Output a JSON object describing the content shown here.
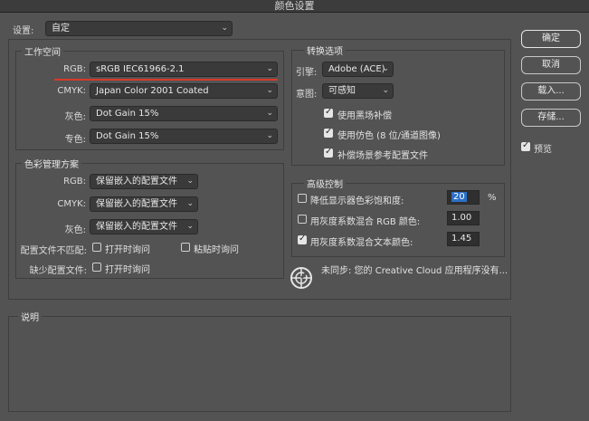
{
  "window": {
    "title": "颜色设置"
  },
  "settings": {
    "label": "设置:",
    "value": "自定"
  },
  "workspace": {
    "title": "工作空间",
    "rgb": {
      "label": "RGB:",
      "value": "sRGB IEC61966-2.1"
    },
    "cmyk": {
      "label": "CMYK:",
      "value": "Japan Color 2001 Coated"
    },
    "gray": {
      "label": "灰色:",
      "value": "Dot Gain 15%"
    },
    "spot": {
      "label": "专色:",
      "value": "Dot Gain 15%"
    }
  },
  "policies": {
    "title": "色彩管理方案",
    "rgb": {
      "label": "RGB:",
      "value": "保留嵌入的配置文件"
    },
    "cmyk": {
      "label": "CMYK:",
      "value": "保留嵌入的配置文件"
    },
    "gray": {
      "label": "灰色:",
      "value": "保留嵌入的配置文件"
    },
    "mismatch_label": "配置文件不匹配:",
    "mismatch_open": "打开时询问",
    "mismatch_paste": "粘贴时询问",
    "missing_label": "缺少配置文件:",
    "missing_open": "打开时询问"
  },
  "conversion": {
    "title": "转换选项",
    "engine": {
      "label": "引擎:",
      "value": "Adobe (ACE)"
    },
    "intent": {
      "label": "意图:",
      "value": "可感知"
    },
    "black_point": "使用黑场补偿",
    "dither": "使用仿色 (8 位/通道图像)",
    "scene_ref": "补偿场景参考配置文件"
  },
  "advanced": {
    "title": "高级控制",
    "desaturate_label": "降低显示器色彩饱和度:",
    "desaturate_value": "20",
    "desaturate_unit": "%",
    "blend_rgb_label": "用灰度系数混合 RGB 颜色:",
    "blend_rgb_value": "1.00",
    "blend_text_label": "用灰度系数混合文本颜色:",
    "blend_text_value": "1.45"
  },
  "sync": {
    "text": "未同步: 您的 Creative Cloud 应用程序没有..."
  },
  "description": {
    "title": "说明"
  },
  "buttons": {
    "ok": "确定",
    "cancel": "取消",
    "load": "载入...",
    "save": "存储...",
    "preview": "预览"
  },
  "colors": {
    "accent_line": "#d73a2a",
    "selection": "#2c6fc6"
  }
}
